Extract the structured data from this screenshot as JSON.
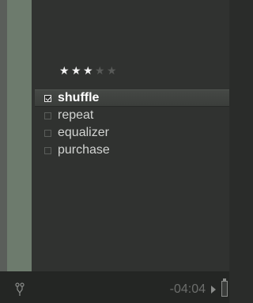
{
  "rating": {
    "value": 3,
    "max": 5,
    "stars": [
      "on",
      "on",
      "on",
      "off",
      "off"
    ]
  },
  "menu": {
    "items": [
      {
        "label": "shuffle",
        "checked": true,
        "selected": true
      },
      {
        "label": "repeat",
        "checked": false,
        "selected": false
      },
      {
        "label": "equalizer",
        "checked": false,
        "selected": false
      },
      {
        "label": "purchase",
        "checked": false,
        "selected": false
      }
    ]
  },
  "status": {
    "time": "-04:04",
    "left_icon": "sync-icon",
    "play_icon": "play-icon",
    "battery_icon": "battery-icon"
  },
  "colors": {
    "background": "#2a2c2a",
    "side_bar": "#6d7b6d",
    "star_on": "#f4f4f4",
    "star_off": "#585a58",
    "selected_text": "#ffffff",
    "time_text": "#6c6e6c"
  }
}
